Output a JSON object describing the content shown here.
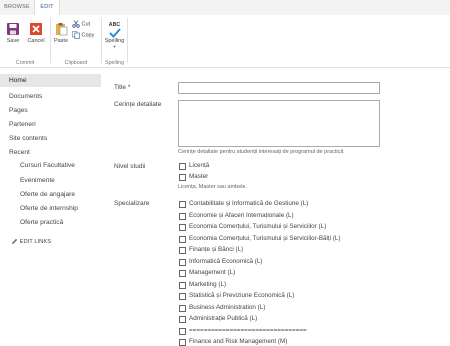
{
  "tabs": [
    "BROWSE",
    "EDIT"
  ],
  "ribbon": {
    "commit": {
      "save": "Save",
      "cancel": "Cancel",
      "group": "Commit"
    },
    "clipboard": {
      "paste": "Paste",
      "cut": "Cut",
      "copy": "Copy",
      "group": "Clipboard"
    },
    "spelling": {
      "abc": "ABC",
      "label": "Spelling",
      "group": "Spelling"
    }
  },
  "nav": {
    "items": [
      "Home",
      "Documents",
      "Pages",
      "Parteneri",
      "Site contents",
      "Recent"
    ],
    "recent": [
      "Cursuri Facultative",
      "Evenimente",
      "Oferte de angajare",
      "Oferte de internship",
      "Oferte practică"
    ],
    "edit_links": "EDIT LINKS"
  },
  "form": {
    "title_label": "Title *",
    "title_value": "",
    "cerinte_label": "Cerințe detaliate",
    "cerinte_hint": "Cerințe detaliate pentru studenții interesați de programul de practică",
    "nivel_label": "Nivel studii",
    "nivel_options": [
      "Licență",
      "Master"
    ],
    "nivel_hint": "Licența, Master sau ambele.",
    "specializare_label": "Specializare",
    "specializare_options": [
      "Contabilitate și Informatică de Gestiune (L)",
      "Economie și Afaceri Internaționale (L)",
      "Economia Comerțului, Turismului și Serviciilor (L)",
      "Economia Comerțului, Turismului și Serviciilor-Bălți (L)",
      "Finanțe și Bănci (L)",
      "Informatică Economică (L)",
      "Management (L)",
      "Marketing (L)",
      "Statistică și Previziune Economică (L)",
      "Business Administration (L)",
      "Administrație Publică (L)",
      "================================",
      "Finance and Risk Management (M)"
    ]
  },
  "colors": {
    "accent": "#2b579a",
    "check": "#2a8dd4",
    "save": "#80397b",
    "cancel": "#d9492b"
  }
}
